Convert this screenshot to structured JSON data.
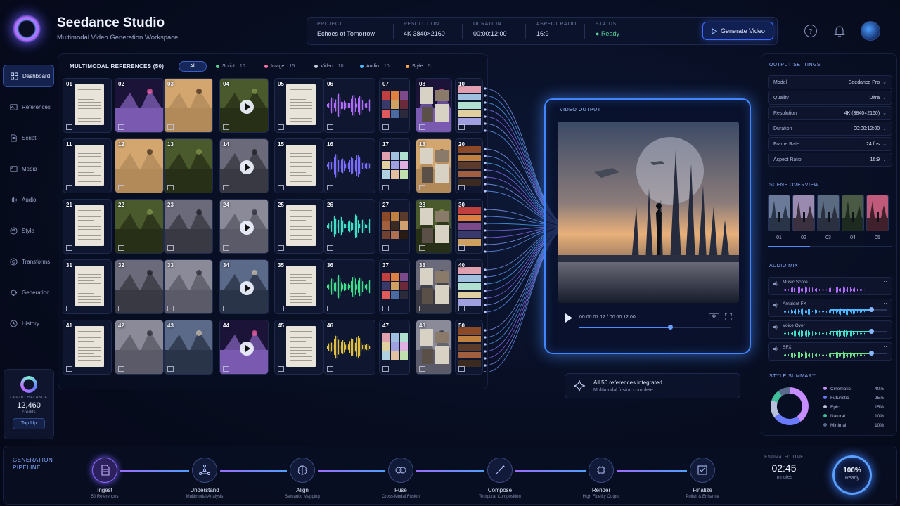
{
  "header": {
    "title": "Seedance Studio",
    "subtitle": "Multimodal Video Generation Workspace",
    "project": {
      "label": "PROJECT",
      "value": "Echoes of Tomorrow"
    },
    "resolution": {
      "label": "RESOLUTION",
      "value": "4K 3840×2160"
    },
    "duration": {
      "label": "DURATION",
      "value": "00:00:12:00"
    },
    "aspect": {
      "label": "ASPECT RATIO",
      "value": "16:9"
    },
    "status": {
      "label": "STATUS",
      "value": "Ready"
    },
    "generate_label": "Generate Video"
  },
  "sidebar": {
    "items": [
      {
        "label": "Dashboard",
        "icon": "dashboard-icon"
      },
      {
        "label": "References",
        "icon": "references-icon"
      },
      {
        "label": "Script",
        "icon": "script-icon"
      },
      {
        "label": "Media",
        "icon": "media-icon"
      },
      {
        "label": "Audio",
        "icon": "audio-icon"
      },
      {
        "label": "Style",
        "icon": "style-icon"
      },
      {
        "label": "Transforms",
        "icon": "transforms-icon"
      },
      {
        "label": "Generation",
        "icon": "generation-icon"
      },
      {
        "label": "History",
        "icon": "history-icon"
      }
    ],
    "credit": {
      "label": "CREDIT BALANCE",
      "value": "12,460",
      "unit": "credits",
      "button": "Top Up"
    }
  },
  "references": {
    "title": "MULTIMODAL REFERENCES (50)",
    "filters": [
      {
        "label": "All"
      },
      {
        "label": "Script",
        "count": "10",
        "color": "#58d39a"
      },
      {
        "label": "Image",
        "count": "15",
        "color": "#ff6fa8"
      },
      {
        "label": "Video",
        "count": "10",
        "color": "#c6cbe0"
      },
      {
        "label": "Audio",
        "count": "10",
        "color": "#4cb8ff"
      },
      {
        "label": "Style",
        "count": "5",
        "color": "#ffa64d"
      }
    ],
    "tiles": [
      "01",
      "02",
      "03",
      "04",
      "05",
      "06",
      "07",
      "08",
      "09",
      "10",
      "11",
      "12",
      "13",
      "14",
      "15",
      "16",
      "17",
      "18",
      "19",
      "20",
      "21",
      "22",
      "23",
      "24",
      "25",
      "26",
      "27",
      "28",
      "29",
      "30",
      "31",
      "32",
      "33",
      "34",
      "35",
      "36",
      "37",
      "38",
      "39",
      "40",
      "41",
      "42",
      "43",
      "44",
      "45",
      "46",
      "47",
      "48",
      "49",
      "50"
    ]
  },
  "video": {
    "label": "VIDEO OUTPUT",
    "time": "00:00:07:12  /  00:00:12:00",
    "badge": "4K",
    "progress": 0.6
  },
  "integration": {
    "title": "All 50 references integrated",
    "subtitle": "Multimodal fusion complete"
  },
  "output": {
    "title": "OUTPUT SETTINGS",
    "settings": [
      {
        "k": "Model",
        "v": "Seedance Pro"
      },
      {
        "k": "Quality",
        "v": "Ultra"
      },
      {
        "k": "Resolution",
        "v": "4K (3840×2160)"
      },
      {
        "k": "Duration",
        "v": "00:00:12:00"
      },
      {
        "k": "Frame Rate",
        "v": "24 fps"
      },
      {
        "k": "Aspect Ratio",
        "v": "16:9"
      }
    ]
  },
  "scenes": {
    "title": "SCENE OVERVIEW",
    "items": [
      "01",
      "02",
      "03",
      "04",
      "05"
    ]
  },
  "audio": {
    "title": "AUDIO MIX",
    "tracks": [
      {
        "name": "Music Score",
        "color": "#b06bff",
        "level": 0.7
      },
      {
        "name": "Ambient FX",
        "color": "#4cb8ff",
        "level": 0.72
      },
      {
        "name": "Voice Over",
        "color": "#3ee0c8",
        "level": 0.72
      },
      {
        "name": "SFX",
        "color": "#6fe08a",
        "level": 0.72
      }
    ]
  },
  "style": {
    "title": "STYLE SUMMARY",
    "items": [
      {
        "name": "Cinematic",
        "pct": "40%",
        "value": 40,
        "color": "#c78cff"
      },
      {
        "name": "Futuristic",
        "pct": "25%",
        "value": 25,
        "color": "#6a7bff"
      },
      {
        "name": "Epic",
        "pct": "15%",
        "value": 15,
        "color": "#b9c0dc"
      },
      {
        "name": "Natural",
        "pct": "10%",
        "value": 10,
        "color": "#3fbf9a"
      },
      {
        "name": "Minimal",
        "pct": "10%",
        "value": 10,
        "color": "#5a6a8c"
      }
    ]
  },
  "pipeline": {
    "title_1": "GENERATION",
    "title_2": "PIPELINE",
    "stages": [
      {
        "name": "Ingest",
        "sub": "50 References",
        "icon": "document-icon"
      },
      {
        "name": "Understand",
        "sub": "Multimodal Analysis",
        "icon": "network-icon"
      },
      {
        "name": "Align",
        "sub": "Semantic Mapping",
        "icon": "brain-icon"
      },
      {
        "name": "Fuse",
        "sub": "Cross-Modal Fusion",
        "icon": "fusion-icon"
      },
      {
        "name": "Compose",
        "sub": "Temporal Composition",
        "icon": "magic-wand-icon"
      },
      {
        "name": "Render",
        "sub": "High Fidelity Output",
        "icon": "chip-icon"
      },
      {
        "name": "Finalize",
        "sub": "Polish & Enhance",
        "icon": "check-icon"
      }
    ],
    "estimated": {
      "label": "ESTIMATED TIME",
      "value": "02:45",
      "unit": "minutes"
    },
    "completion": {
      "value": "100%",
      "label": "Ready"
    }
  }
}
